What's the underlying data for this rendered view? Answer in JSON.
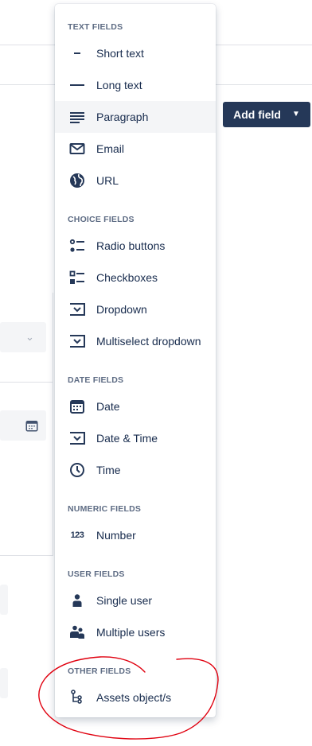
{
  "add_field_button": {
    "label": "Add field"
  },
  "menu": {
    "sections": [
      {
        "header": "TEXT FIELDS",
        "items": [
          {
            "label": "Short text",
            "icon": "short-text-icon"
          },
          {
            "label": "Long text",
            "icon": "long-text-icon"
          },
          {
            "label": "Paragraph",
            "icon": "paragraph-icon",
            "selected": true
          },
          {
            "label": "Email",
            "icon": "email-icon"
          },
          {
            "label": "URL",
            "icon": "globe-icon"
          }
        ]
      },
      {
        "header": "CHOICE FIELDS",
        "items": [
          {
            "label": "Radio buttons",
            "icon": "radio-buttons-icon"
          },
          {
            "label": "Checkboxes",
            "icon": "checkboxes-icon"
          },
          {
            "label": "Dropdown",
            "icon": "dropdown-icon"
          },
          {
            "label": "Multiselect dropdown",
            "icon": "multiselect-dropdown-icon"
          }
        ]
      },
      {
        "header": "DATE FIELDS",
        "items": [
          {
            "label": "Date",
            "icon": "calendar-icon"
          },
          {
            "label": "Date & Time",
            "icon": "date-time-icon"
          },
          {
            "label": "Time",
            "icon": "clock-icon"
          }
        ]
      },
      {
        "header": "NUMERIC FIELDS",
        "items": [
          {
            "label": "Number",
            "icon": "number-icon",
            "icon_text": "123"
          }
        ]
      },
      {
        "header": "USER FIELDS",
        "items": [
          {
            "label": "Single user",
            "icon": "single-user-icon"
          },
          {
            "label": "Multiple users",
            "icon": "multiple-users-icon"
          }
        ]
      },
      {
        "header": "OTHER FIELDS",
        "items": [
          {
            "label": "Assets object/s",
            "icon": "assets-object-icon"
          }
        ]
      }
    ]
  },
  "colors": {
    "button_bg": "#253858",
    "annotation": "#e0000f",
    "selected_bg": "#f4f5f7"
  }
}
